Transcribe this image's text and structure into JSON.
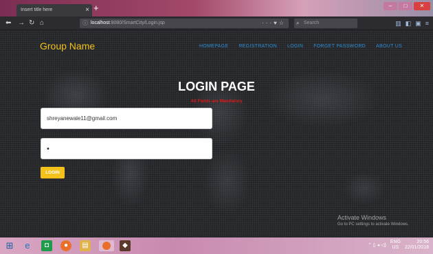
{
  "browser": {
    "tab_title": "Insert title here",
    "url_host": "localhost",
    "url_path": ":8080/SmartCity/Login.jsp",
    "search_placeholder": "Search"
  },
  "site": {
    "brand": "Group Name",
    "menu": [
      "HOMEPAGE",
      "REGISTRATION",
      "LOGIN",
      "FORGET PASSWORD",
      "ABOUT US"
    ]
  },
  "login": {
    "title": "LOGIN PAGE",
    "notice": "All Fields are Mandatory",
    "email_value": "shreyanewale11@gmail.com",
    "password_value": "•",
    "button_label": "LOGIN"
  },
  "watermark": {
    "line1": "Activate Windows",
    "line2": "Go to PC settings to activate Windows."
  },
  "taskbar": {
    "language": "ENG",
    "region": "US",
    "time": "20:56",
    "date": "22/01/2018"
  },
  "colors": {
    "accent": "#f2c21a",
    "menu_link": "#2f8fd0",
    "notice": "#e01818",
    "page_bg": "#24262a"
  }
}
